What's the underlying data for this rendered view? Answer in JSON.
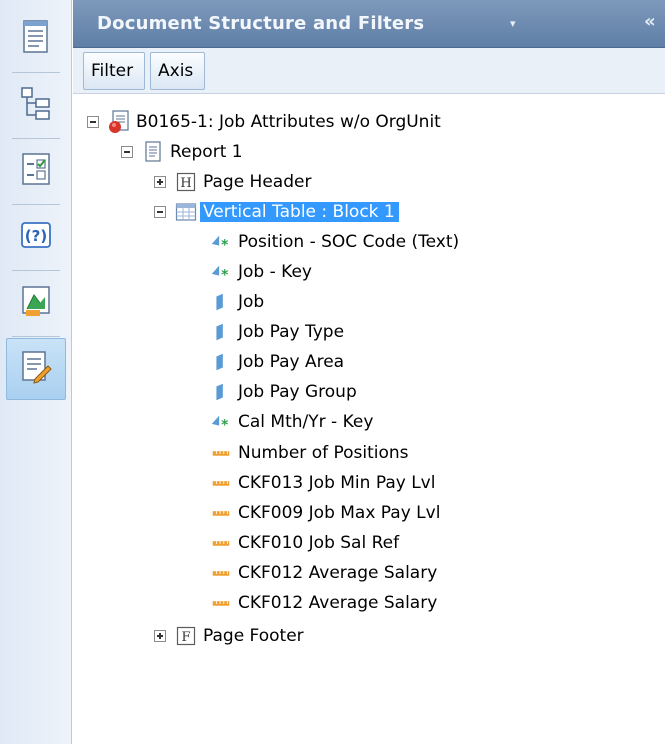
{
  "header": {
    "title": "Document Structure and Filters",
    "caret": "▾",
    "collapse": "«"
  },
  "tabs": [
    {
      "label": "Filter"
    },
    {
      "label": "Axis"
    }
  ],
  "left_toolbar": {
    "items": [
      {
        "icon": "document-list-icon"
      },
      {
        "icon": "structure-tree-icon"
      },
      {
        "icon": "checklist-icon"
      },
      {
        "icon": "help-icon"
      },
      {
        "icon": "chart-icon"
      },
      {
        "icon": "edit-document-icon",
        "active": true
      }
    ]
  },
  "tree": {
    "root": {
      "label": "B0165-1: Job Attributes w/o OrgUnit",
      "expanded": true,
      "icon": "document-query-icon"
    },
    "report": {
      "label": "Report 1",
      "expanded": true,
      "icon": "report-icon"
    },
    "page_header": {
      "label": "Page Header",
      "expanded": false,
      "icon": "header-h-icon"
    },
    "table": {
      "label": "Vertical Table : Block 1",
      "expanded": true,
      "selected": true,
      "icon": "table-icon"
    },
    "objects": [
      {
        "label": "Position - SOC Code (Text)",
        "kind": "attribute-key"
      },
      {
        "label": "Job - Key",
        "kind": "attribute-key"
      },
      {
        "label": "Job",
        "kind": "dimension"
      },
      {
        "label": "Job Pay Type",
        "kind": "dimension"
      },
      {
        "label": "Job Pay Area",
        "kind": "dimension"
      },
      {
        "label": "Job Pay Group",
        "kind": "dimension"
      },
      {
        "label": "Cal Mth/Yr - Key",
        "kind": "attribute-key"
      },
      {
        "label": "Number of Positions",
        "kind": "measure"
      },
      {
        "label": "CKF013 Job Min Pay Lvl",
        "kind": "measure"
      },
      {
        "label": "CKF009 Job Max Pay Lvl",
        "kind": "measure"
      },
      {
        "label": "CKF010 Job Sal Ref",
        "kind": "measure"
      },
      {
        "label": "CKF012 Average Salary",
        "kind": "measure"
      },
      {
        "label": "CKF012 Average Salary",
        "kind": "measure"
      }
    ],
    "page_footer": {
      "label": "Page Footer",
      "expanded": false,
      "icon": "footer-f-icon"
    }
  },
  "colors": {
    "header_bg": "#6f8db3",
    "selection": "#3399ff",
    "measure_icon": "#f0a030",
    "dimension_icon": "#5b9bd5",
    "key_star": "#2e9e50"
  }
}
